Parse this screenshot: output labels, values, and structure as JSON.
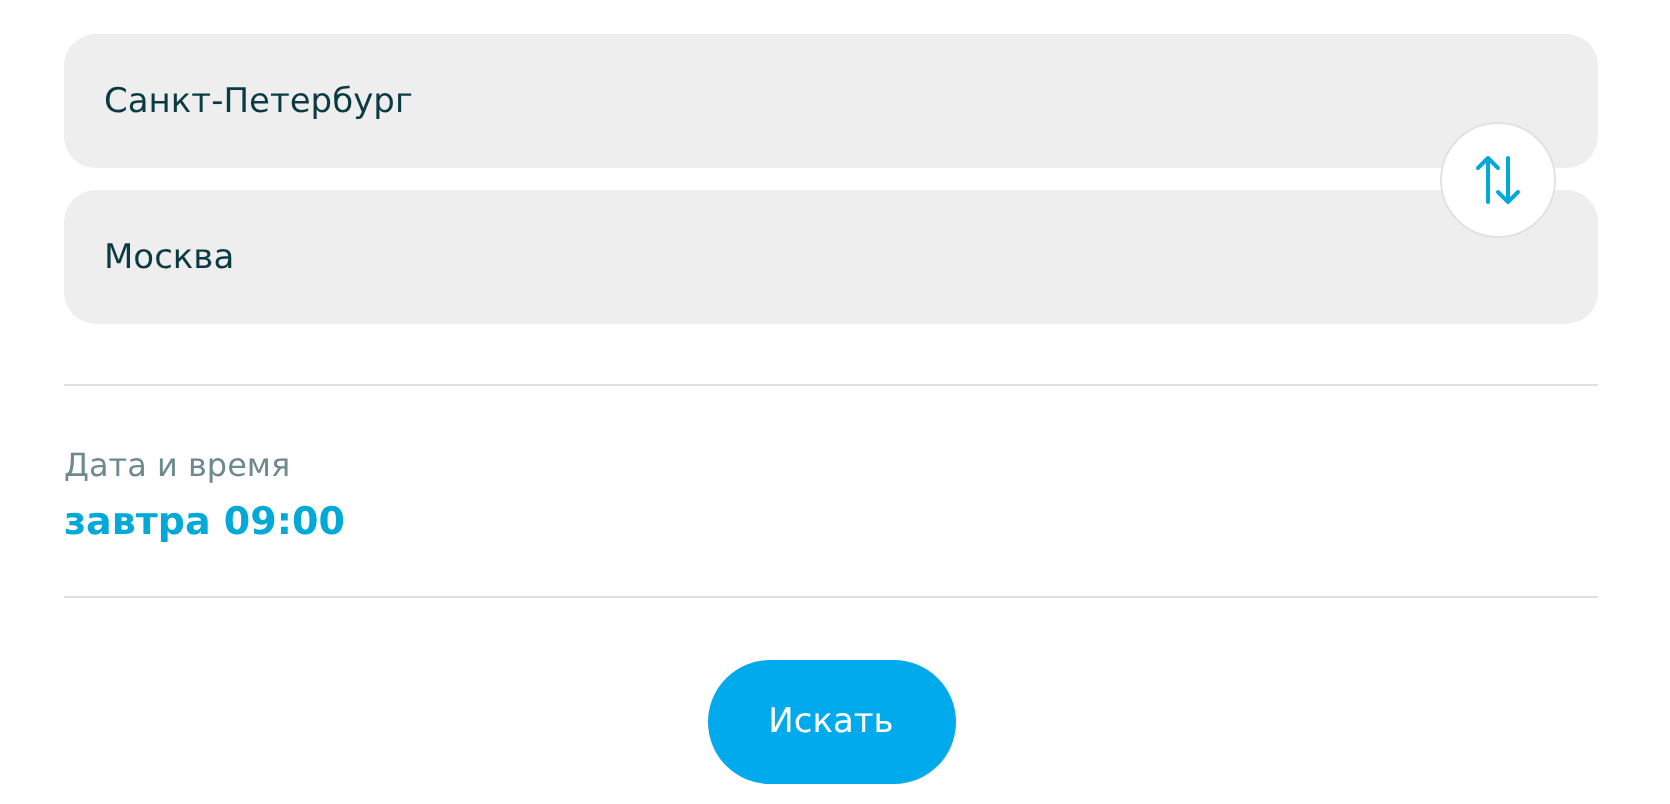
{
  "route": {
    "from": {
      "value": "Санкт-Петербург"
    },
    "to": {
      "value": "Москва"
    }
  },
  "datetime": {
    "label": "Дата и время",
    "value": "завтра 09:00"
  },
  "search_button": {
    "label": "Искать"
  }
}
